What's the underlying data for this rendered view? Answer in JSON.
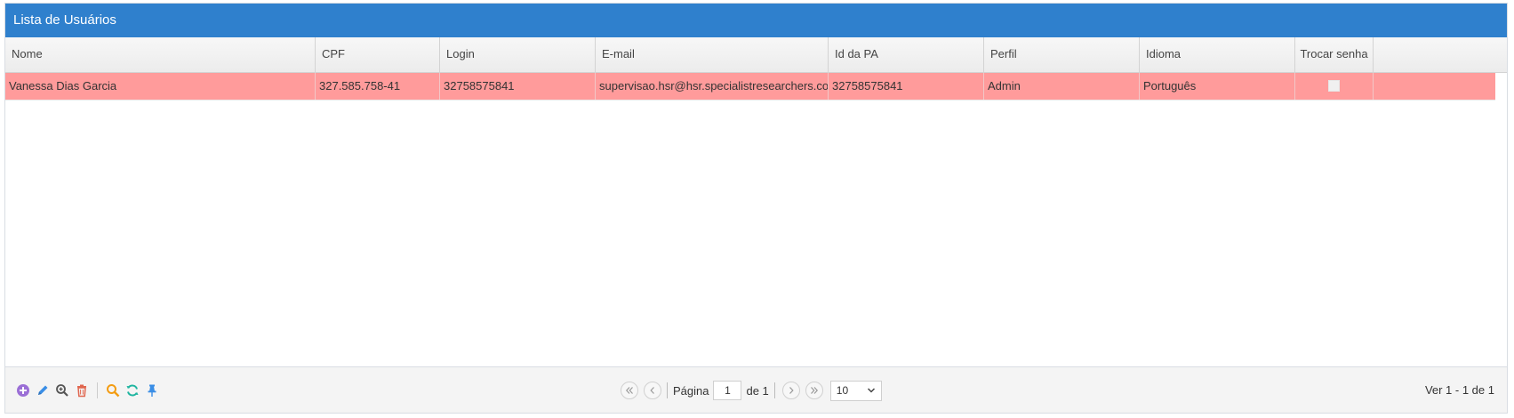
{
  "grid": {
    "caption": "Lista de Usuários"
  },
  "columns": [
    "Nome",
    "CPF",
    "Login",
    "E-mail",
    "Id da PA",
    "Perfil",
    "Idioma",
    "Trocar senha"
  ],
  "rows": [
    {
      "nome": "Vanessa Dias Garcia",
      "cpf": "327.585.758-41",
      "login": "32758575841",
      "email": "supervisao.hsr@hsr.specialistresearchers.com",
      "id_pa": "32758575841",
      "perfil": "Admin",
      "idioma": "Português",
      "trocar_senha": false
    }
  ],
  "toolbar": {
    "icons": [
      "add-icon",
      "edit-icon",
      "view-icon",
      "delete-icon",
      "search-icon",
      "refresh-icon",
      "pin-icon"
    ]
  },
  "pager": {
    "page_label": "Página",
    "page_value": "1",
    "of_label": "de 1",
    "rows_per_page": "10",
    "info": "Ver 1 - 1 de 1"
  },
  "colors": {
    "caption_bg": "#2f80cd",
    "row_highlight": "#ff9b9b"
  }
}
